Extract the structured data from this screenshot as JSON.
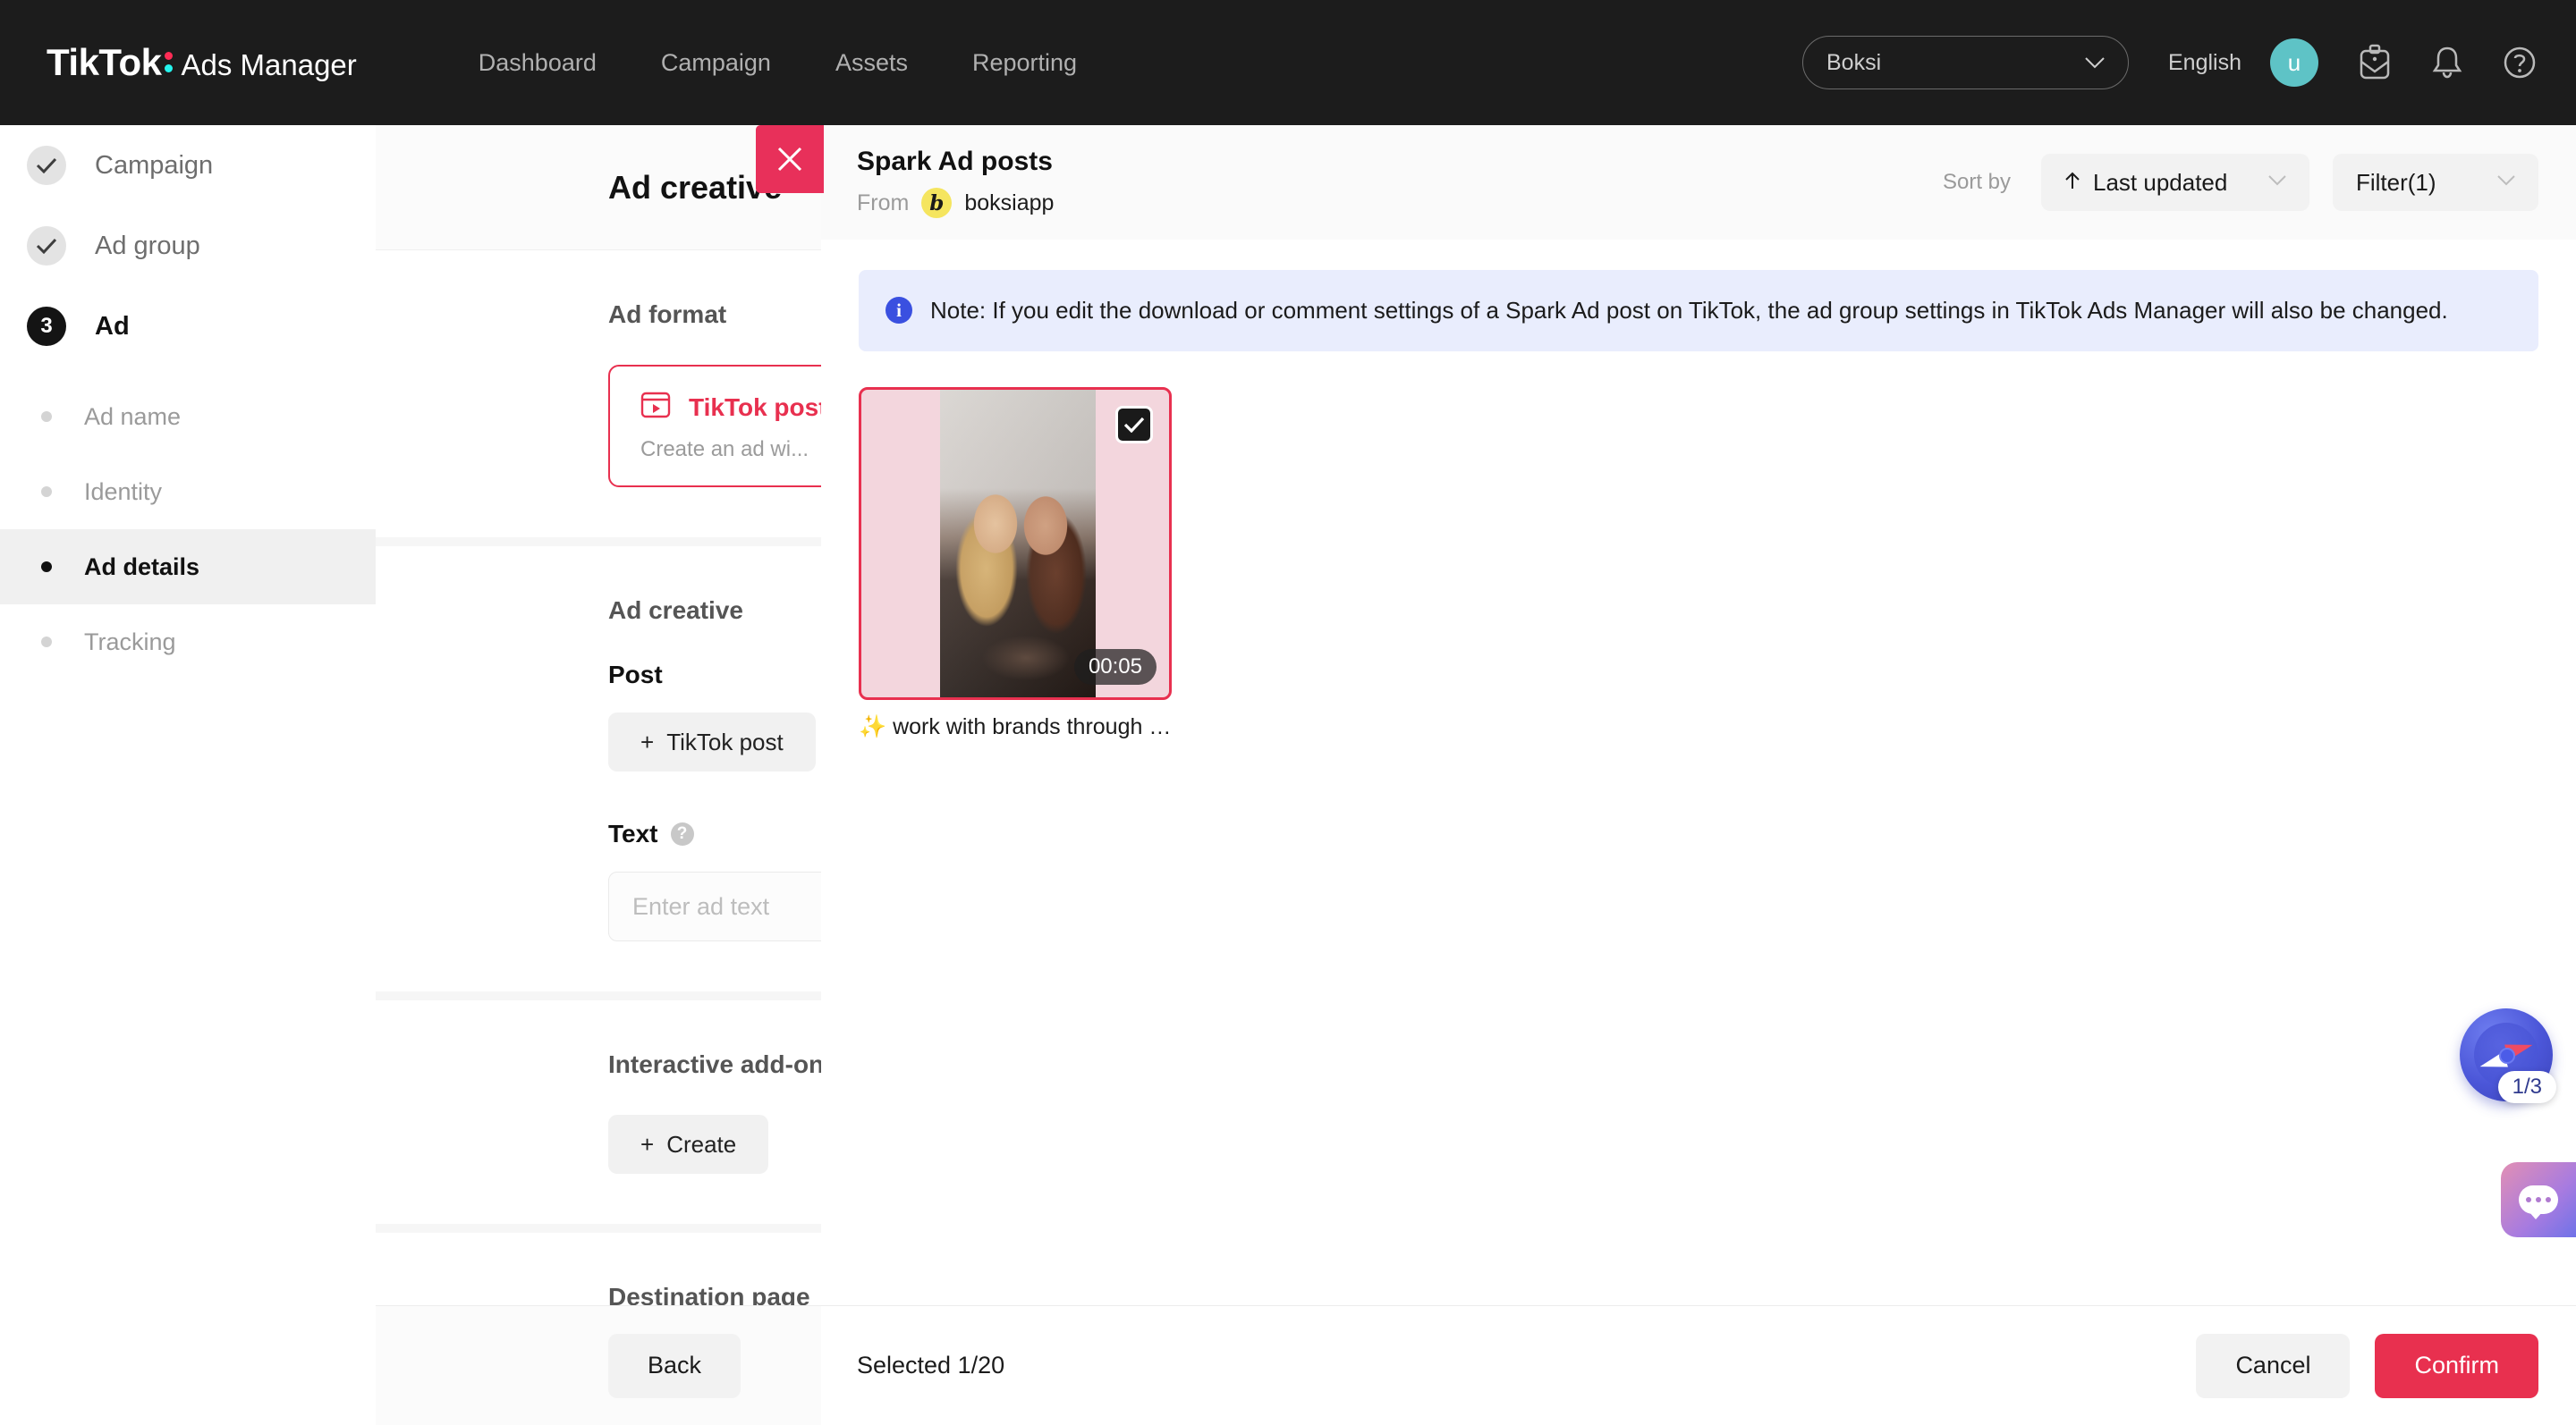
{
  "topnav": {
    "brand_main": "TikTok",
    "brand_sub": "Ads Manager",
    "links": [
      "Dashboard",
      "Campaign",
      "Assets",
      "Reporting"
    ],
    "account": "Boksi",
    "language": "English",
    "avatar_initial": "u",
    "icons": [
      "inbox-icon",
      "bell-icon",
      "help-icon"
    ]
  },
  "steps": {
    "main": [
      {
        "label": "Campaign",
        "state": "done",
        "badge": "check"
      },
      {
        "label": "Ad group",
        "state": "done",
        "badge": "check"
      },
      {
        "label": "Ad",
        "state": "active",
        "badge": "3"
      }
    ],
    "sub": [
      {
        "label": "Ad name",
        "selected": false
      },
      {
        "label": "Identity",
        "selected": false
      },
      {
        "label": "Ad details",
        "selected": true
      },
      {
        "label": "Tracking",
        "selected": false
      }
    ]
  },
  "form": {
    "title": "Ad creative",
    "ad_format_title": "Ad format",
    "format_option": {
      "title": "TikTok post",
      "desc": "Create an ad wi...",
      "icon": "video-frame-icon"
    },
    "ad_creative_title": "Ad creative",
    "post_label": "Post",
    "post_button": "TikTok post",
    "text_label": "Text",
    "text_placeholder": "Enter ad text",
    "addons_title": "Interactive add-ons",
    "addons_create": "Create",
    "destination_title": "Destination page",
    "back_button": "Back"
  },
  "modal": {
    "close_icon": "close-icon",
    "title": "Spark Ad posts",
    "from_label": "From",
    "handle": "boksiapp",
    "avatar_glyph": "b",
    "sort_by_label": "Sort by",
    "sort_value": "Last updated",
    "sort_direction_icon": "arrow-up-icon",
    "filter_value": "Filter(1)",
    "note": "Note: If you edit the download or comment settings of a Spark Ad post on TikTok, the ad group settings in TikTok Ads Manager will also be changed.",
    "posts": [
      {
        "caption": "✨ work with brands through Bo...",
        "duration": "00:05",
        "selected": true
      }
    ],
    "selected_count": "Selected 1/20",
    "cancel_label": "Cancel",
    "confirm_label": "Confirm"
  },
  "widgets": {
    "compass_badge": "1/3",
    "compass_icon": "compass-icon",
    "chat_icon": "chat-bubble-icon"
  },
  "colors": {
    "accent": "#e8304f",
    "nav_bg": "#1c1c1c",
    "avatar_bg": "#5ec3c6",
    "note_bg": "#e9edfd",
    "note_icon": "#3a50e0"
  }
}
